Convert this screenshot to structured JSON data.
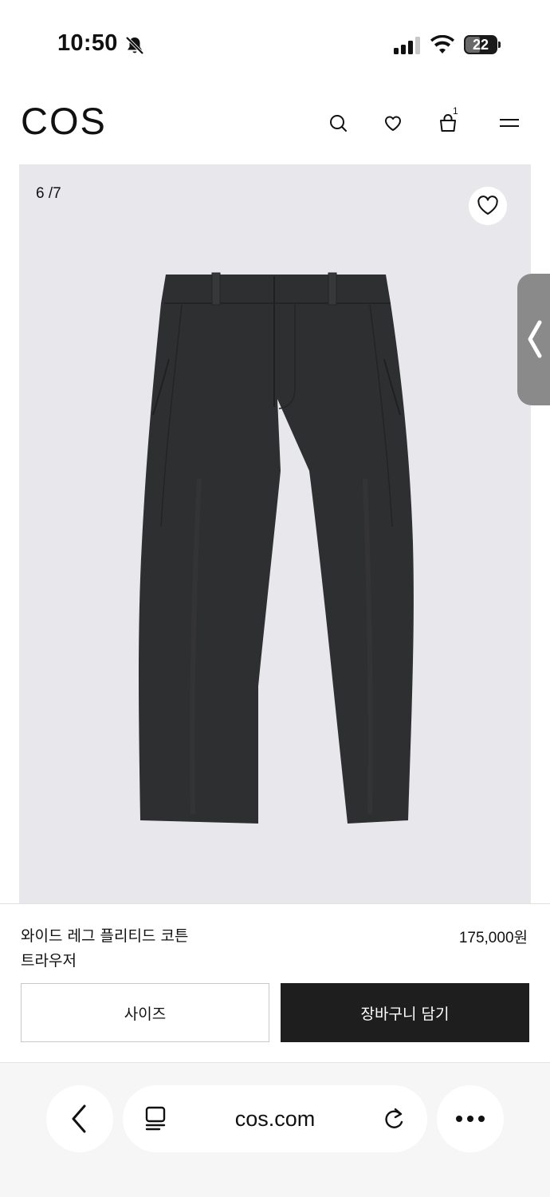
{
  "status_bar": {
    "time": "10:50",
    "battery": "22",
    "icons": [
      "bell-slash-icon",
      "cellular-signal-icon",
      "wifi-icon",
      "battery-icon"
    ]
  },
  "header": {
    "logo": "COS",
    "cart_count": "1",
    "icons": [
      "search-icon",
      "heart-icon",
      "shopping-bag-icon",
      "menu-icon"
    ]
  },
  "gallery": {
    "counter": "6 /7",
    "background_color": "#e8e8ec",
    "product_color": "#2e2f31"
  },
  "product": {
    "name_line1": "와이드 레그 플리티드 코튼",
    "name_line2": "트라우저",
    "price": "175,000원"
  },
  "actions": {
    "size_label": "사이즈",
    "add_to_cart_label": "장바구니 담기"
  },
  "browser": {
    "url": "cos.com",
    "icons": [
      "back-icon",
      "tabs-icon",
      "reload-icon",
      "more-icon"
    ]
  }
}
